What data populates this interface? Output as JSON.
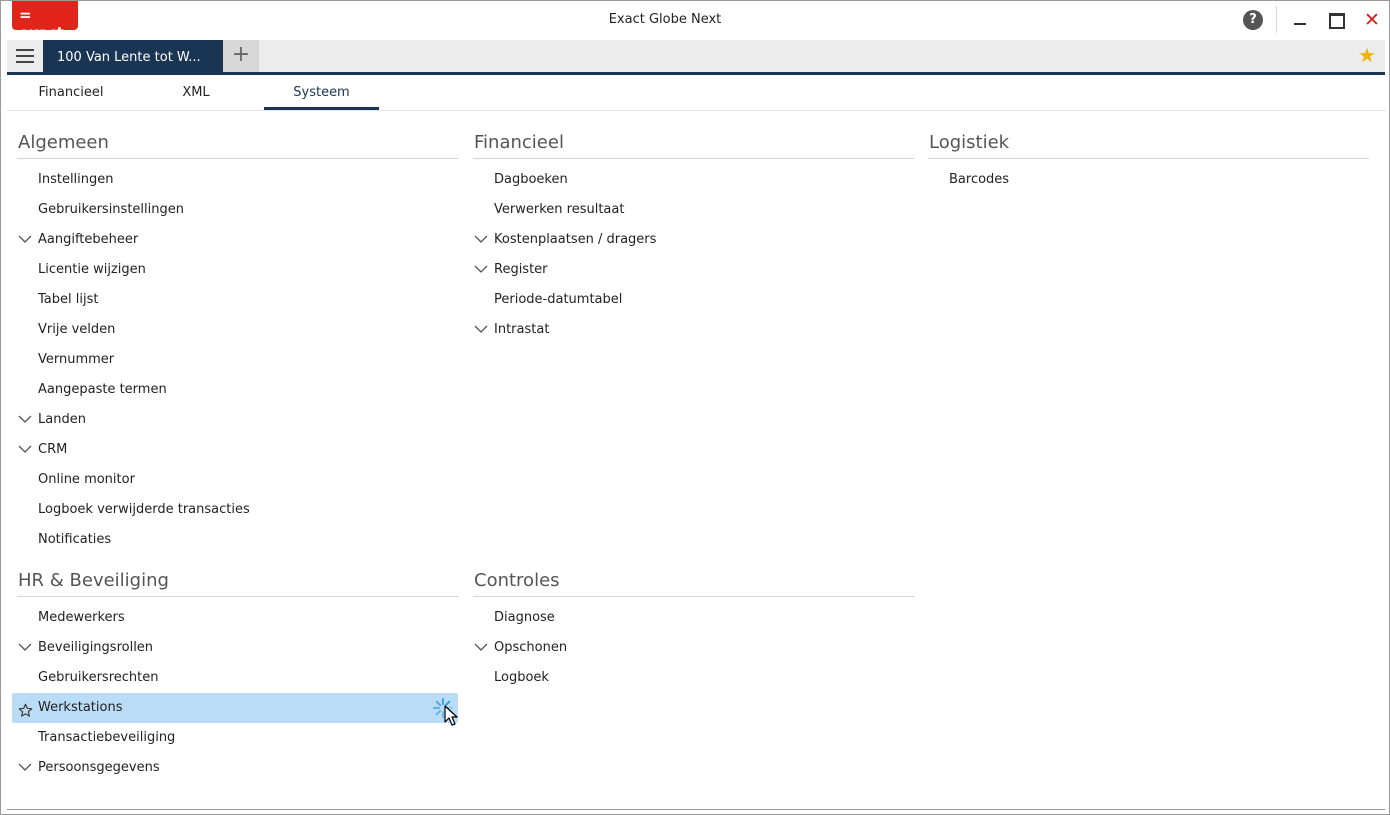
{
  "window": {
    "logo_text": "= exact",
    "title": "Exact Globe Next",
    "help_label": "?",
    "close_label": "✕"
  },
  "tabbar": {
    "doc_tab_label": "100  Van Lente tot W...",
    "add_tab_label": "+",
    "favorite_icon": "star-icon"
  },
  "subtabs": [
    {
      "label": "Financieel",
      "active": false
    },
    {
      "label": "XML",
      "active": false
    },
    {
      "label": "Systeem",
      "active": true
    }
  ],
  "sections": {
    "algemeen": {
      "title": "Algemeen",
      "items": [
        {
          "label": "Instellingen",
          "expandable": false
        },
        {
          "label": "Gebruikersinstellingen",
          "expandable": false
        },
        {
          "label": "Aangiftebeheer",
          "expandable": true
        },
        {
          "label": "Licentie wijzigen",
          "expandable": false
        },
        {
          "label": "Tabel lijst",
          "expandable": false
        },
        {
          "label": "Vrije velden",
          "expandable": false
        },
        {
          "label": "Vernummer",
          "expandable": false
        },
        {
          "label": "Aangepaste termen",
          "expandable": false
        },
        {
          "label": "Landen",
          "expandable": true
        },
        {
          "label": "CRM",
          "expandable": true
        },
        {
          "label": "Online monitor",
          "expandable": false
        },
        {
          "label": "Logboek verwijderde transacties",
          "expandable": false
        },
        {
          "label": "Notificaties",
          "expandable": false
        }
      ]
    },
    "financieel": {
      "title": "Financieel",
      "items": [
        {
          "label": "Dagboeken",
          "expandable": false
        },
        {
          "label": "Verwerken resultaat",
          "expandable": false
        },
        {
          "label": "Kostenplaatsen / dragers",
          "expandable": true
        },
        {
          "label": "Register",
          "expandable": true
        },
        {
          "label": "Periode-datumtabel",
          "expandable": false
        },
        {
          "label": "Intrastat",
          "expandable": true
        }
      ]
    },
    "logistiek": {
      "title": "Logistiek",
      "items": [
        {
          "label": "Barcodes",
          "expandable": false
        }
      ]
    },
    "hr": {
      "title": "HR & Beveiliging",
      "items": [
        {
          "label": "Medewerkers",
          "expandable": false
        },
        {
          "label": "Beveiligingsrollen",
          "expandable": true
        },
        {
          "label": "Gebruikersrechten",
          "expandable": false
        },
        {
          "label": "Werkstations",
          "expandable": false,
          "selected": true
        },
        {
          "label": "Transactiebeveiliging",
          "expandable": false
        },
        {
          "label": "Persoonsgegevens",
          "expandable": true
        }
      ]
    },
    "controles": {
      "title": "Controles",
      "items": [
        {
          "label": "Diagnose",
          "expandable": false
        },
        {
          "label": "Opschonen",
          "expandable": true
        },
        {
          "label": "Logboek",
          "expandable": false
        }
      ]
    }
  },
  "colors": {
    "brand_red": "#e1251b",
    "navy": "#1a3554",
    "selection": "#bbdcf7",
    "favorite": "#f0b400"
  }
}
